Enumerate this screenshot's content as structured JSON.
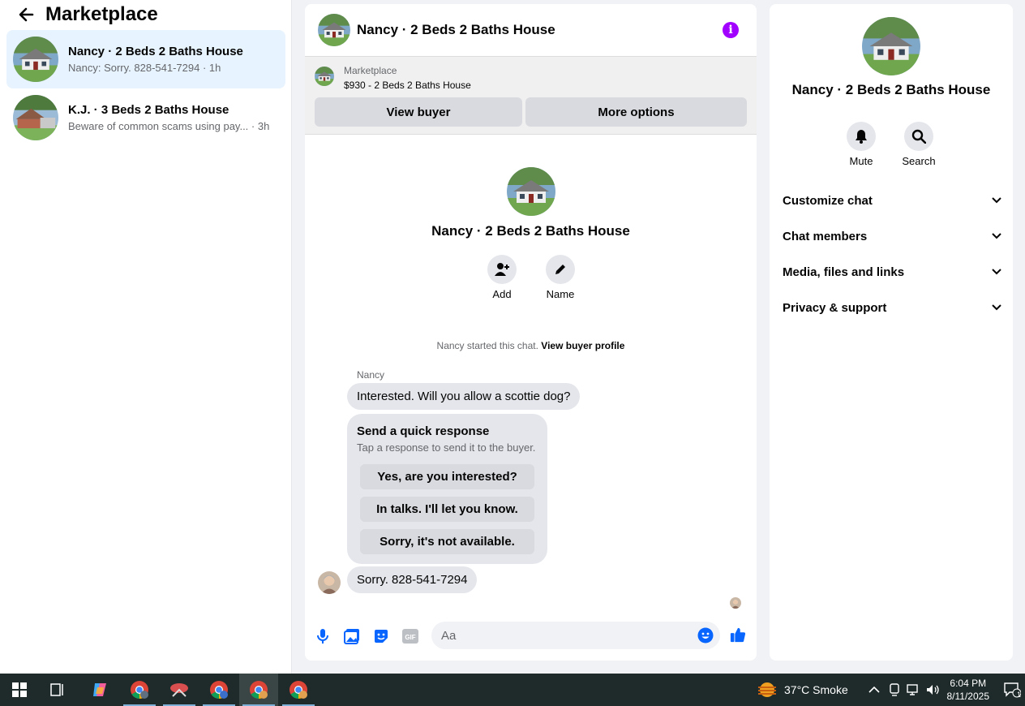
{
  "left_panel": {
    "title": "Marketplace",
    "conversations": [
      {
        "title": "Nancy · 2 Beds 2 Baths House",
        "preview": "Nancy: Sorry. 828-541-7294 · 1h",
        "active": true
      },
      {
        "title": "K.J. · 3 Beds 2 Baths House",
        "preview": "Beware of common scams using pay...   · 3h",
        "active": false
      }
    ]
  },
  "chat": {
    "title": "Nancy · 2 Beds 2 Baths House",
    "listing": {
      "label": "Marketplace",
      "price_title": "$930 - 2 Beds 2 Baths House",
      "view_buyer_label": "View buyer",
      "more_options_label": "More options"
    },
    "profile_name": "Nancy · 2 Beds 2 Baths House",
    "add_label": "Add",
    "name_label": "Name",
    "started_text": "Nancy started this chat.",
    "view_buyer_profile": "View buyer profile",
    "sender": "Nancy",
    "message_1": "Interested. Will you allow a scottie dog?",
    "quick_response": {
      "title": "Send a quick response",
      "subtitle": "Tap a response to send it to the buyer.",
      "options": [
        "Yes, are you interested?",
        "In talks. I'll let you know.",
        "Sorry, it's not available."
      ]
    },
    "message_2": "Sorry. 828-541-7294",
    "composer_placeholder": "Aa"
  },
  "right_panel": {
    "name": "Nancy · 2 Beds 2 Baths House",
    "mute_label": "Mute",
    "search_label": "Search",
    "sections": [
      "Customize chat",
      "Chat members",
      "Media, files and links",
      "Privacy & support"
    ]
  },
  "taskbar": {
    "weather": "37°C  Smoke",
    "time": "6:04 PM",
    "date": "8/11/2025",
    "notification_count": "1"
  },
  "colors": {
    "accent": "#0866ff",
    "info": "#a100ff",
    "active_row": "#e7f3ff"
  }
}
